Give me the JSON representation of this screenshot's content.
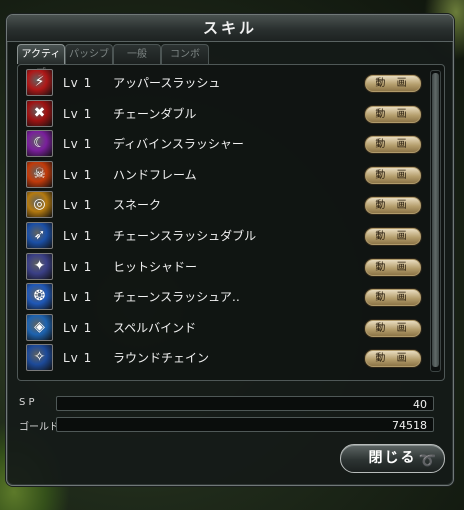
{
  "window": {
    "title": "スキル",
    "tabs": [
      {
        "label": "アクティブ",
        "active": true
      },
      {
        "label": "パッシブ",
        "active": false
      },
      {
        "label": "一般",
        "active": false
      },
      {
        "label": "コンボ",
        "active": false
      }
    ]
  },
  "skills": [
    {
      "level": "Lv 1",
      "name": "アッパースラッシュ",
      "video": "動 画",
      "icon": "upper-slash-icon",
      "icon_color": "#b01818",
      "glyph": "⚡"
    },
    {
      "level": "Lv 1",
      "name": "チェーンダブル",
      "video": "動 画",
      "icon": "chain-double-icon",
      "icon_color": "#a01212",
      "glyph": "✖"
    },
    {
      "level": "Lv 1",
      "name": "ディバインスラッシャー",
      "video": "動 画",
      "icon": "divine-slasher-icon",
      "icon_color": "#7a1f9c",
      "glyph": "☾"
    },
    {
      "level": "Lv 1",
      "name": "ハンドフレーム",
      "video": "動 画",
      "icon": "hand-flame-icon",
      "icon_color": "#c23a0a",
      "glyph": "☠"
    },
    {
      "level": "Lv 1",
      "name": "スネーク",
      "video": "動 画",
      "icon": "snake-icon",
      "icon_color": "#b47a10",
      "glyph": "◎"
    },
    {
      "level": "Lv 1",
      "name": "チェーンスラッシュダブル",
      "video": "動 画",
      "icon": "chain-slash-double-icon",
      "icon_color": "#1a4fa6",
      "glyph": "➶"
    },
    {
      "level": "Lv 1",
      "name": "ヒットシャドー",
      "video": "動 画",
      "icon": "hit-shadow-icon",
      "icon_color": "#3a3f86",
      "glyph": "✦"
    },
    {
      "level": "Lv 1",
      "name": "チェーンスラッシュア‥",
      "video": "動 画",
      "icon": "chain-slash-icon",
      "icon_color": "#1f58b8",
      "glyph": "❂"
    },
    {
      "level": "Lv 1",
      "name": "スペルバインド",
      "video": "動 画",
      "icon": "spell-bind-icon",
      "icon_color": "#1d63b0",
      "glyph": "◈"
    },
    {
      "level": "Lv 1",
      "name": "ラウンドチェイン",
      "video": "動 画",
      "icon": "round-chain-icon",
      "icon_color": "#1c4a9a",
      "glyph": "✧"
    }
  ],
  "stats": {
    "sp_label": "S P",
    "sp_value": "40",
    "gold_label": "ゴールド",
    "gold_value": "74518"
  },
  "footer": {
    "close_label": "閉じる"
  }
}
